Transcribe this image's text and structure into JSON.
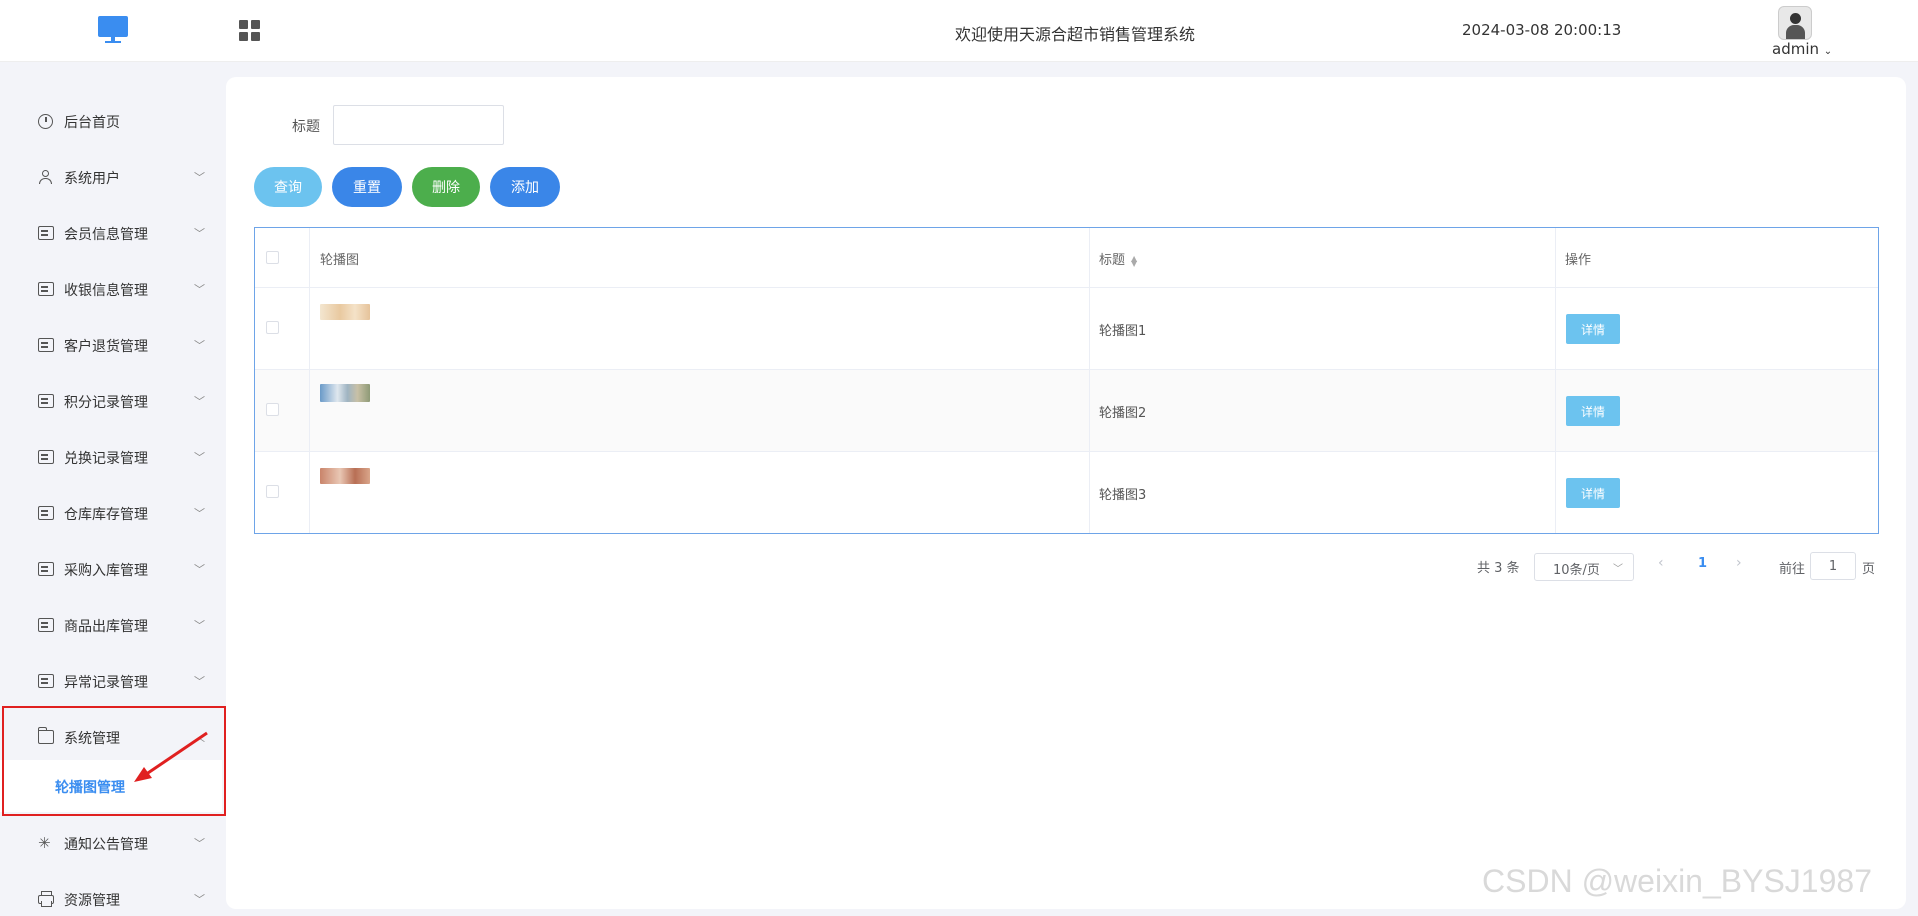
{
  "header": {
    "title": "欢迎使用天源合超市销售管理系统",
    "time": "2024-03-08 20:00:13",
    "user": "admin"
  },
  "sidebar": {
    "items": [
      {
        "label": "后台首页",
        "icon": "clock-icon"
      },
      {
        "label": "系统用户",
        "icon": "user-icon"
      },
      {
        "label": "会员信息管理",
        "icon": "card-icon"
      },
      {
        "label": "收银信息管理",
        "icon": "card-icon"
      },
      {
        "label": "客户退货管理",
        "icon": "card-icon"
      },
      {
        "label": "积分记录管理",
        "icon": "card-icon"
      },
      {
        "label": "兑换记录管理",
        "icon": "card-icon"
      },
      {
        "label": "仓库库存管理",
        "icon": "card-icon"
      },
      {
        "label": "采购入库管理",
        "icon": "card-icon"
      },
      {
        "label": "商品出库管理",
        "icon": "card-icon"
      },
      {
        "label": "异常记录管理",
        "icon": "card-icon"
      },
      {
        "label": "系统管理",
        "icon": "folder-icon"
      },
      {
        "label": "通知公告管理",
        "icon": "loader-icon"
      },
      {
        "label": "资源管理",
        "icon": "printer-icon"
      }
    ],
    "active_sub": "轮播图管理"
  },
  "search": {
    "label": "标题",
    "value": ""
  },
  "buttons": {
    "query": "查询",
    "reset": "重置",
    "delete": "删除",
    "add": "添加"
  },
  "table": {
    "headers": {
      "image": "轮播图",
      "title": "标题",
      "action": "操作"
    },
    "rows": [
      {
        "title": "轮播图1",
        "action": "详情"
      },
      {
        "title": "轮播图2",
        "action": "详情"
      },
      {
        "title": "轮播图3",
        "action": "详情"
      }
    ]
  },
  "pagination": {
    "total": "共 3 条",
    "page_size": "10条/页",
    "current": "1",
    "goto_label": "前往",
    "jump_value": "1",
    "page_suffix": "页"
  },
  "watermark": "CSDN @weixin_BYSJ1987",
  "colors": {
    "accent": "#3a8df0",
    "query_button": "#6cc3ef",
    "delete_button": "#4cae4c",
    "highlight_box": "#e02020"
  }
}
